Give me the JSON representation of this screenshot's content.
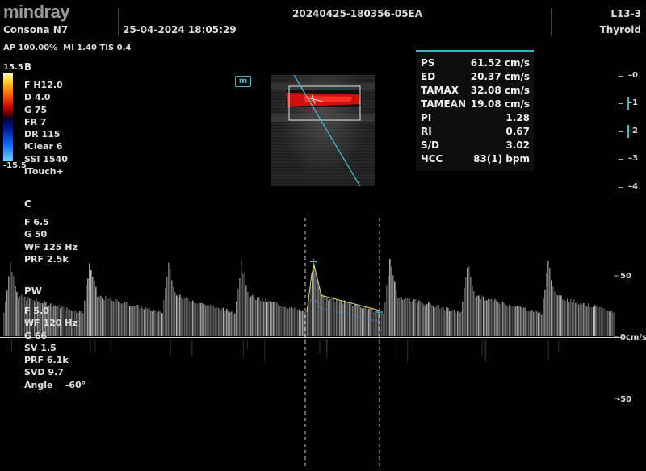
{
  "header": {
    "logo": "mindray",
    "model": "Consona N7",
    "datetime": "25-04-2024  18:05:29",
    "patient_id": "20240425-180356-05EA",
    "probe": "L13-3",
    "preset": "Thyroid",
    "output": "AP 100.00%  MI 1.40 TIS 0.4"
  },
  "colorbar": {
    "top": "15.5",
    "bottom": "-15.5"
  },
  "bmode": {
    "label": "B",
    "params": [
      "F H12.0",
      "D 4.0",
      "G 75",
      "FR 7",
      "DR 115",
      "iClear 6",
      "SSI 1540",
      "iTouch+"
    ]
  },
  "color": {
    "label": "C",
    "params": [
      "F 6.5",
      "G 50",
      "WF 125 Hz",
      "PRF 2.5k"
    ]
  },
  "pw": {
    "label": "PW",
    "params": [
      "F 5.0",
      "WF 120 Hz",
      "G 66",
      "SV 1.5",
      "PRF 6.1k",
      "SVD 9.7",
      "Angle    -60°"
    ]
  },
  "mode_badge": "m",
  "measurements": [
    {
      "label": "PS",
      "value": "61.52 cm/s"
    },
    {
      "label": "ED",
      "value": "20.37 cm/s"
    },
    {
      "label": "TAMAX",
      "value": "32.08 cm/s"
    },
    {
      "label": "TAMEAN",
      "value": "19.08 cm/s"
    },
    {
      "label": "PI",
      "value": "1.28"
    },
    {
      "label": "RI",
      "value": "0.67"
    },
    {
      "label": "S/D",
      "value": "3.02"
    },
    {
      "label": "ЧСС",
      "value": "83(1) bpm"
    }
  ],
  "depth_scale": [
    "0",
    "1",
    "2",
    "3",
    "4"
  ],
  "doppler_scale": {
    "top": "50",
    "baseline": "0cm/s",
    "bottom": "-50"
  },
  "doppler": {
    "velocity_range": [
      -75,
      75
    ],
    "peaks_x": [
      12,
      110,
      208,
      298,
      388,
      482,
      578,
      678
    ],
    "peak_velocity": 61.52,
    "end_diastolic_velocity": 20.37
  },
  "colors": {
    "accent": "#3fb6c8",
    "trace": "#e8e070",
    "mean_trace": "#4a78d8"
  }
}
